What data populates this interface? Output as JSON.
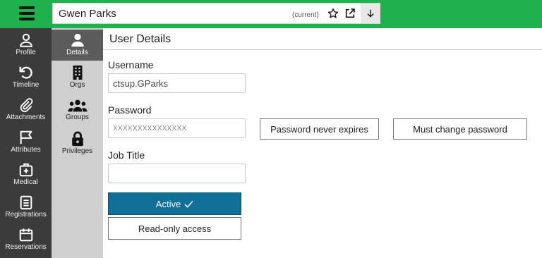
{
  "header": {
    "record_name": "Gwen Parks",
    "current_tag": "(current)",
    "icons": [
      "hamburger-menu-icon",
      "star-icon",
      "open-external-icon",
      "arrow-down-icon"
    ]
  },
  "nav": {
    "items": [
      {
        "label": "Profile",
        "icon": "user-icon"
      },
      {
        "label": "Timeline",
        "icon": "history-icon"
      },
      {
        "label": "Attachments",
        "icon": "paperclip-icon"
      },
      {
        "label": "Attributes",
        "icon": "flag-icon"
      },
      {
        "label": "Medical",
        "icon": "medical-kit-icon"
      },
      {
        "label": "Registrations",
        "icon": "clipboard-icon"
      },
      {
        "label": "Reservations",
        "icon": "calendar-icon"
      }
    ]
  },
  "subnav": {
    "items": [
      {
        "label": "Details",
        "icon": "user-solid-icon",
        "active": true
      },
      {
        "label": "Orgs",
        "icon": "building-icon"
      },
      {
        "label": "Groups",
        "icon": "users-icon"
      },
      {
        "label": "Privileges",
        "icon": "lock-icon"
      }
    ]
  },
  "main": {
    "title": "User Details",
    "username_label": "Username",
    "username_value": "ctsup.GParks",
    "password_label": "Password",
    "password_value": "XXXXXXXXXXXXXXX",
    "jobtitle_label": "Job Title",
    "jobtitle_value": "",
    "never_expires_label": "Password never expires",
    "must_change_label": "Must change password",
    "active_label": "Active",
    "readonly_label": "Read-only access"
  },
  "colors": {
    "topbar": "#1fb14d",
    "nav_dark": "#3b3b3b",
    "subnav": "#cfcfcf",
    "subnav_active": "#5b5b5b",
    "active_button": "#0f6f96"
  }
}
